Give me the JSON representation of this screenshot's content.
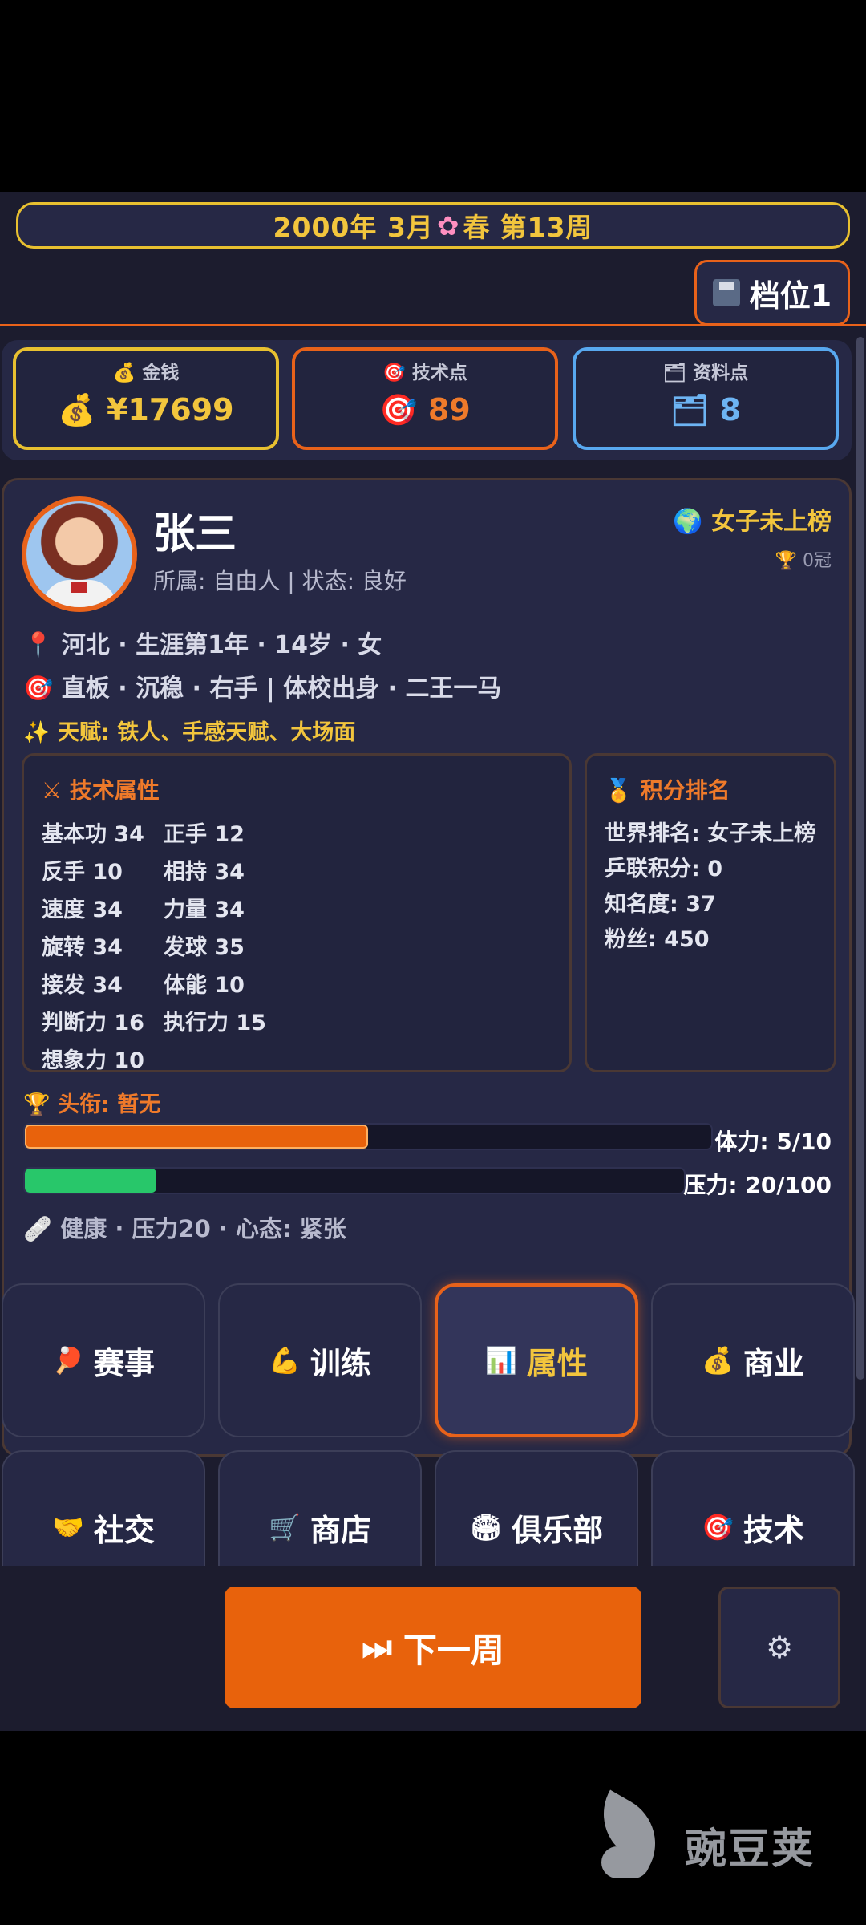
{
  "header": {
    "date": "2000年 3月",
    "season_icon": "cherry-blossom",
    "season": "春",
    "week": "第13周",
    "save_slot": "档位1"
  },
  "stats": {
    "money": {
      "label": "金钱",
      "value": "¥17699",
      "icon": "money-bag"
    },
    "skill_points": {
      "label": "技术点",
      "value": "89",
      "icon": "target"
    },
    "data_points": {
      "label": "资料点",
      "value": "8",
      "icon": "folder"
    }
  },
  "player": {
    "name": "张三",
    "meta": "所属: 自由人 | 状态: 良好",
    "rank_tag": "女子未上榜",
    "crowns": "0冠",
    "info1": "河北 · 生涯第1年 · 14岁 · 女",
    "info2": "直板 · 沉稳 · 右手 | 体校出身 · 二王一马",
    "talent_label": "天赋:",
    "talent_value": "铁人、手感天赋、大场面"
  },
  "tech_panel": {
    "title": "技术属性",
    "attributes": [
      "基本功 34",
      "正手 12",
      "反手 10",
      "相持 34",
      "速度 34",
      "力量 34",
      "旋转 34",
      "发球 35",
      "接发 34",
      "体能 10",
      "判断力 16",
      "执行力 15",
      "想象力 10"
    ]
  },
  "rank_panel": {
    "title": "积分排名",
    "lines": [
      "世界排名: 女子未上榜",
      "乒联积分: 0",
      "知名度: 37",
      "粉丝: 450"
    ]
  },
  "title_line": {
    "label": "头衔:",
    "value": "暂无"
  },
  "bars": {
    "stamina": {
      "label": "体力: 5/10",
      "fraction": 0.5
    },
    "pressure": {
      "label": "压力: 20/100",
      "fraction": 0.2
    }
  },
  "status_line": "健康 · 压力20 · 心态: 紧张",
  "menu": [
    {
      "label": "赛事",
      "icon": "ping-pong"
    },
    {
      "label": "训练",
      "icon": "flexed-bicep"
    },
    {
      "label": "属性",
      "icon": "bar-chart"
    },
    {
      "label": "商业",
      "icon": "money-bag"
    },
    {
      "label": "社交",
      "icon": "handshake"
    },
    {
      "label": "商店",
      "icon": "shopping-cart"
    },
    {
      "label": "俱乐部",
      "icon": "stadium"
    },
    {
      "label": "技术",
      "icon": "target"
    }
  ],
  "actions": {
    "next_week": "下一周",
    "settings_icon": "gear"
  },
  "watermark": "豌豆荚",
  "colors": {
    "accent_orange": "#e8621a",
    "gold": "#f2c53d",
    "blue": "#58a8ef",
    "green": "#28c76a",
    "background": "#1c1c2e",
    "card": "#262845"
  }
}
